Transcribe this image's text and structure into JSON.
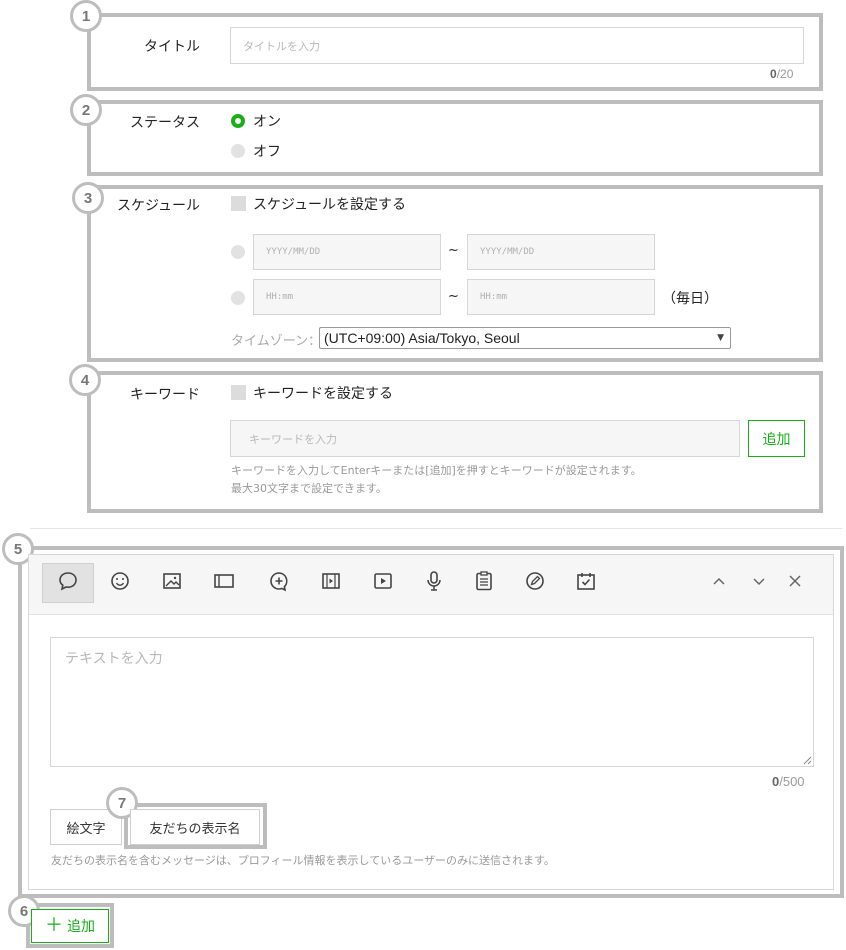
{
  "title_section": {
    "badge": "1",
    "label": "タイトル",
    "placeholder": "タイトルを入力",
    "counter_current": "0",
    "counter_max": "/20"
  },
  "status_section": {
    "badge": "2",
    "label": "ステータス",
    "options": [
      "オン",
      "オフ"
    ],
    "selected": "オン"
  },
  "schedule_section": {
    "badge": "3",
    "label": "スケジュール",
    "checkbox_label": "スケジュールを設定する",
    "date_start_placeholder": "YYYY/MM/DD",
    "date_end_placeholder": "YYYY/MM/DD",
    "time_start_placeholder": "HH:mm",
    "time_end_placeholder": "HH:mm",
    "range_separator": "~",
    "daily_label": "（毎日）",
    "timezone_label": "タイムゾーン：",
    "timezone_value": "(UTC+09:00) Asia/Tokyo, Seoul"
  },
  "keyword_section": {
    "badge": "4",
    "label": "キーワード",
    "checkbox_label": "キーワードを設定する",
    "placeholder": "キーワードを入力",
    "add_button": "追加",
    "help_line1": "キーワードを入力してEnterキーまたは[追加]を押すとキーワードが設定されます。",
    "help_line2": "最大30文字まで設定できます。"
  },
  "message_section": {
    "badge": "5",
    "toolbar_icons": [
      "speech-bubble",
      "smiley",
      "image",
      "card",
      "plus-bubble",
      "video-frame",
      "play",
      "microphone",
      "clipboard",
      "pen-circle",
      "calendar-check"
    ],
    "text_placeholder": "テキストを入力",
    "counter_current": "0",
    "counter_max": "/500",
    "emoji_button": "絵文字",
    "friend_name_badge": "7",
    "friend_name_button": "友だちの表示名",
    "help": "友だちの表示名を含むメッセージは、プロフィール情報を表示しているユーザーのみに送信されます。"
  },
  "add_section": {
    "badge": "6",
    "add_label": "追加",
    "accent_color": "#16b016"
  }
}
